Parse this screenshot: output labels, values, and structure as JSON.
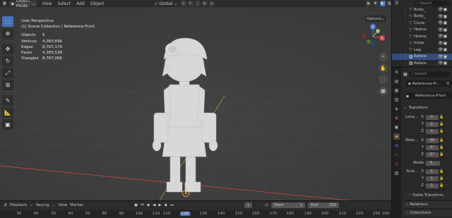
{
  "header": {
    "mode": "Object Mode",
    "menus": [
      "View",
      "Select",
      "Add",
      "Object"
    ],
    "orientation": "Global"
  },
  "viewport": {
    "view_name": "User Perspective",
    "collection": "(1) Scene Collection | Reference-Front",
    "stats": [
      {
        "label": "Objects",
        "value": "6"
      },
      {
        "label": "Vertices",
        "value": "4,383,696"
      },
      {
        "label": "Edges",
        "value": "8,767,179"
      },
      {
        "label": "Faces",
        "value": "4,383,538"
      },
      {
        "label": "Triangles",
        "value": "8,767,066"
      }
    ],
    "options_label": "Options",
    "gizmo": {
      "x": "X",
      "y": "Y",
      "z": "Z"
    }
  },
  "outliner": {
    "search_placeholder": "Search",
    "items": [
      {
        "name": "Body_"
      },
      {
        "name": "Body_"
      },
      {
        "name": "Circle"
      },
      {
        "name": "Helme"
      },
      {
        "name": "Helme"
      },
      {
        "name": "Icosp"
      },
      {
        "name": "Leg"
      },
      {
        "name": "Refere",
        "selected": true
      },
      {
        "name": "Refere"
      }
    ]
  },
  "properties": {
    "search_placeholder": "Search",
    "object_name": "Reference-Fr...",
    "data_name": "Reference-Front",
    "transform_label": "Transform",
    "location": {
      "label": "Loca...",
      "x": "0.",
      "y": "2.",
      "z": "2."
    },
    "rotation": {
      "label": "Rota...",
      "x": "90",
      "y": "0°",
      "z": "0°"
    },
    "mode": {
      "label": "Mode",
      "value": "X..."
    },
    "scale": {
      "label": "Scal...",
      "x": "1.",
      "y": "1.",
      "z": "1."
    },
    "axis_labels": {
      "x": "X",
      "y": "Y",
      "z": "Z"
    },
    "delta_transform": "Delta Transform",
    "relations": "Relations",
    "collections": "Collections"
  },
  "timeline": {
    "menus": [
      "Playback",
      "Keying",
      "View",
      "Marker"
    ],
    "current_frame": "1",
    "start_label": "Start",
    "start": "1",
    "end_label": "End",
    "end": "250",
    "ruler": [
      "30",
      "40",
      "50",
      "60",
      "70",
      "80",
      "90",
      "100",
      "110",
      "120",
      "130",
      "140",
      "150",
      "160",
      "170",
      "180",
      "190",
      "200",
      "210",
      "220",
      "230",
      "240",
      "250"
    ],
    "ruler_current": "120"
  },
  "colors": {
    "accent": "#4772b3",
    "x_axis": "#c84545",
    "y_axis": "#8bc34a",
    "z_axis": "#4a78d0"
  }
}
